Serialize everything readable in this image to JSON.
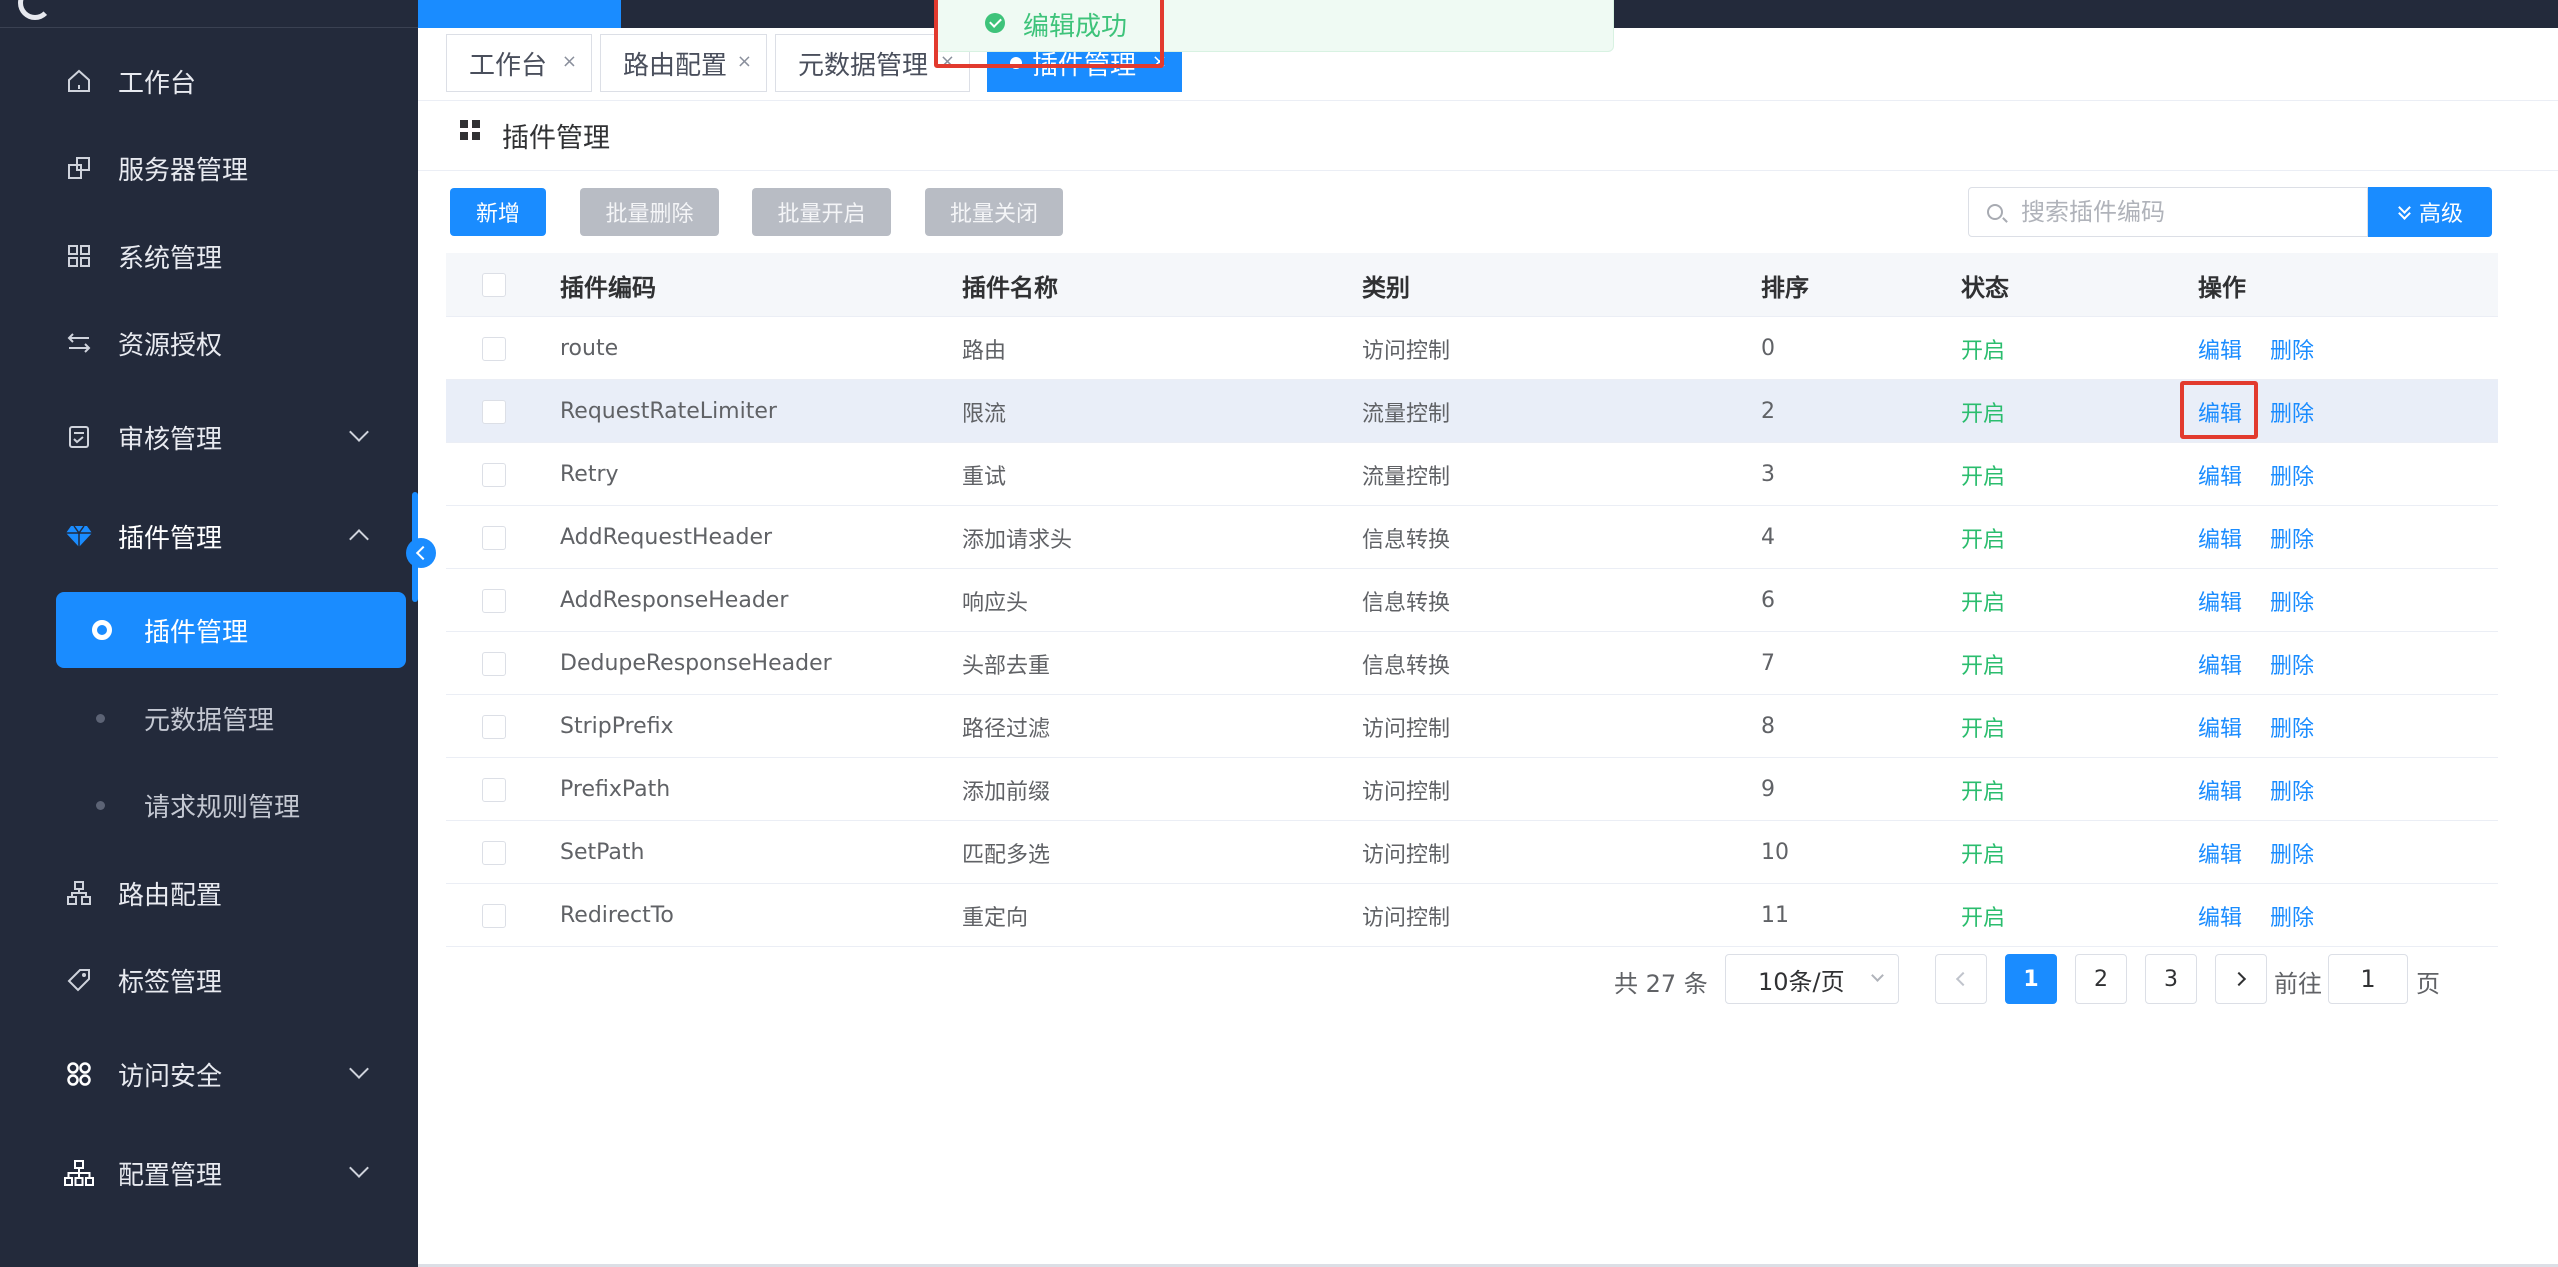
{
  "colors": {
    "sidebar_bg": "#232a3b",
    "primary": "#1a8cff",
    "success": "#2bbd6e",
    "highlight_border": "#e23a2e",
    "disabled_button": "#b8bcc4"
  },
  "toast": {
    "icon": "check-circle-icon",
    "message": "编辑成功"
  },
  "sidebar": {
    "items": [
      {
        "label": "工作台",
        "icon": "home-icon"
      },
      {
        "label": "服务器管理",
        "icon": "server-icon"
      },
      {
        "label": "系统管理",
        "icon": "grid-icon"
      },
      {
        "label": "资源授权",
        "icon": "transfer-icon"
      },
      {
        "label": "审核管理",
        "icon": "audit-icon",
        "expandable": true
      },
      {
        "label": "插件管理",
        "icon": "diamond-icon",
        "expanded": true
      },
      {
        "label": "路由配置",
        "icon": "sitemap-icon"
      },
      {
        "label": "标签管理",
        "icon": "tag-icon"
      },
      {
        "label": "访问安全",
        "icon": "apps-icon",
        "expandable": true
      },
      {
        "label": "配置管理",
        "icon": "org-chart-icon",
        "expandable": true
      }
    ],
    "subitems": [
      {
        "label": "插件管理",
        "active": true
      },
      {
        "label": "元数据管理"
      },
      {
        "label": "请求规则管理"
      }
    ]
  },
  "tabs": [
    {
      "label": "工作台",
      "close": "×"
    },
    {
      "label": "路由配置",
      "close": "×"
    },
    {
      "label": "元数据管理",
      "close": "×"
    },
    {
      "label": "插件管理",
      "close": "×",
      "active": true
    }
  ],
  "page": {
    "title": "插件管理",
    "title_icon": "grid-icon"
  },
  "toolbar": {
    "add": "新增",
    "batch_delete": "批量删除",
    "batch_enable": "批量开启",
    "batch_disable": "批量关闭",
    "search_placeholder": "搜索插件编码",
    "advanced": "高级"
  },
  "table": {
    "headers": [
      "插件编码",
      "插件名称",
      "类别",
      "排序",
      "状态",
      "操作"
    ],
    "rows": [
      {
        "code": "route",
        "name": "路由",
        "category": "访问控制",
        "sort": "0",
        "status": "开启",
        "edit": "编辑",
        "delete": "删除"
      },
      {
        "code": "RequestRateLimiter",
        "name": "限流",
        "category": "流量控制",
        "sort": "2",
        "status": "开启",
        "edit": "编辑",
        "delete": "删除"
      },
      {
        "code": "Retry",
        "name": "重试",
        "category": "流量控制",
        "sort": "3",
        "status": "开启",
        "edit": "编辑",
        "delete": "删除"
      },
      {
        "code": "AddRequestHeader",
        "name": "添加请求头",
        "category": "信息转换",
        "sort": "4",
        "status": "开启",
        "edit": "编辑",
        "delete": "删除"
      },
      {
        "code": "AddResponseHeader",
        "name": "响应头",
        "category": "信息转换",
        "sort": "6",
        "status": "开启",
        "edit": "编辑",
        "delete": "删除"
      },
      {
        "code": "DedupeResponseHeader",
        "name": "头部去重",
        "category": "信息转换",
        "sort": "7",
        "status": "开启",
        "edit": "编辑",
        "delete": "删除"
      },
      {
        "code": "StripPrefix",
        "name": "路径过滤",
        "category": "访问控制",
        "sort": "8",
        "status": "开启",
        "edit": "编辑",
        "delete": "删除"
      },
      {
        "code": "PrefixPath",
        "name": "添加前缀",
        "category": "访问控制",
        "sort": "9",
        "status": "开启",
        "edit": "编辑",
        "delete": "删除"
      },
      {
        "code": "SetPath",
        "name": "匹配多选",
        "category": "访问控制",
        "sort": "10",
        "status": "开启",
        "edit": "编辑",
        "delete": "删除"
      },
      {
        "code": "RedirectTo",
        "name": "重定向",
        "category": "访问控制",
        "sort": "11",
        "status": "开启",
        "edit": "编辑",
        "delete": "删除"
      }
    ]
  },
  "pagination": {
    "total": "共 27 条",
    "page_size": "10条/页",
    "pages": [
      "1",
      "2",
      "3"
    ],
    "current": "1",
    "goto_label": "前往",
    "goto_value": "1",
    "unit": "页"
  }
}
